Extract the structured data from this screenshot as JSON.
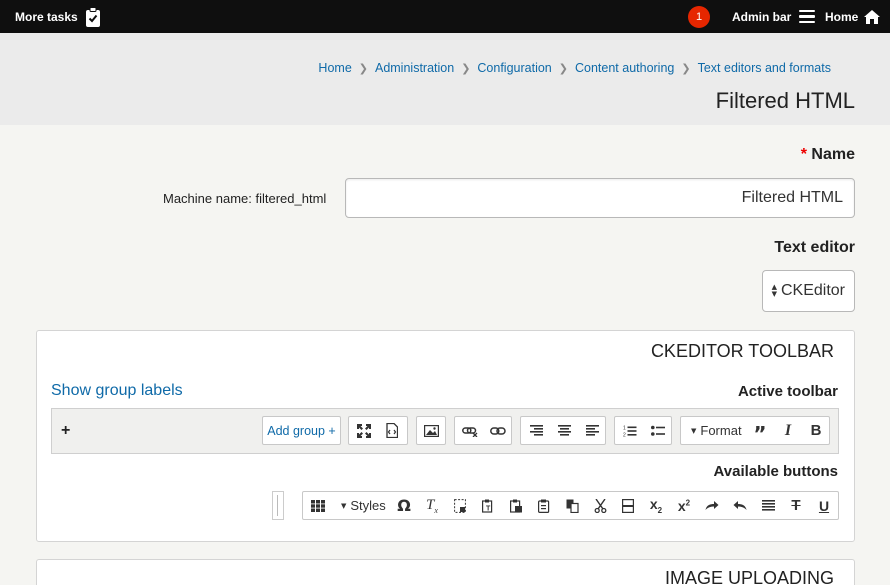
{
  "adminbar": {
    "more_tasks": "More tasks",
    "badge_count": "1",
    "admin_bar": "Admin bar",
    "home": "Home"
  },
  "breadcrumb": [
    "Home",
    "Administration",
    "Configuration",
    "Content authoring",
    "Text editors and formats"
  ],
  "page_title": "Filtered HTML",
  "form": {
    "name_label": "Name",
    "name_required_mark": "*",
    "machine_name": "Machine name: filtered_html",
    "name_value": "Filtered HTML",
    "editor_label": "Text editor",
    "editor_value": "CKEditor"
  },
  "toolbar_section": {
    "legend": "CKEDITOR TOOLBAR",
    "show_group_labels": "Show group labels",
    "active_toolbar": "Active toolbar",
    "add_group": "Add group +",
    "add_row": "+",
    "format_label": "Format",
    "available_buttons": "Available buttons",
    "styles_label": "Styles"
  },
  "next_section": {
    "legend": "IMAGE UPLOADING"
  },
  "icons": {
    "active": [
      "maximize-icon",
      "source-icon",
      "image-icon",
      "unlink-icon",
      "link-icon",
      "align-right-icon",
      "align-center-icon",
      "align-left-icon",
      "numbered-list-icon",
      "bulleted-list-icon",
      "format-dropdown",
      "blockquote-icon",
      "italic-icon",
      "bold-icon"
    ],
    "available": [
      "table-icon",
      "styles-dropdown",
      "special-char-icon",
      "remove-format-icon",
      "show-blocks-icon",
      "paste-text-icon",
      "paste-word-icon",
      "paste-icon",
      "copy-icon",
      "cut-icon",
      "horizontal-rule-icon",
      "subscript-icon",
      "superscript-icon",
      "redo-icon",
      "undo-icon",
      "justify-icon",
      "strikethrough-icon",
      "underline-icon"
    ]
  },
  "colors": {
    "link": "#0f6aa8",
    "badge": "#e62600",
    "adminbar": "#0f0f0f"
  }
}
